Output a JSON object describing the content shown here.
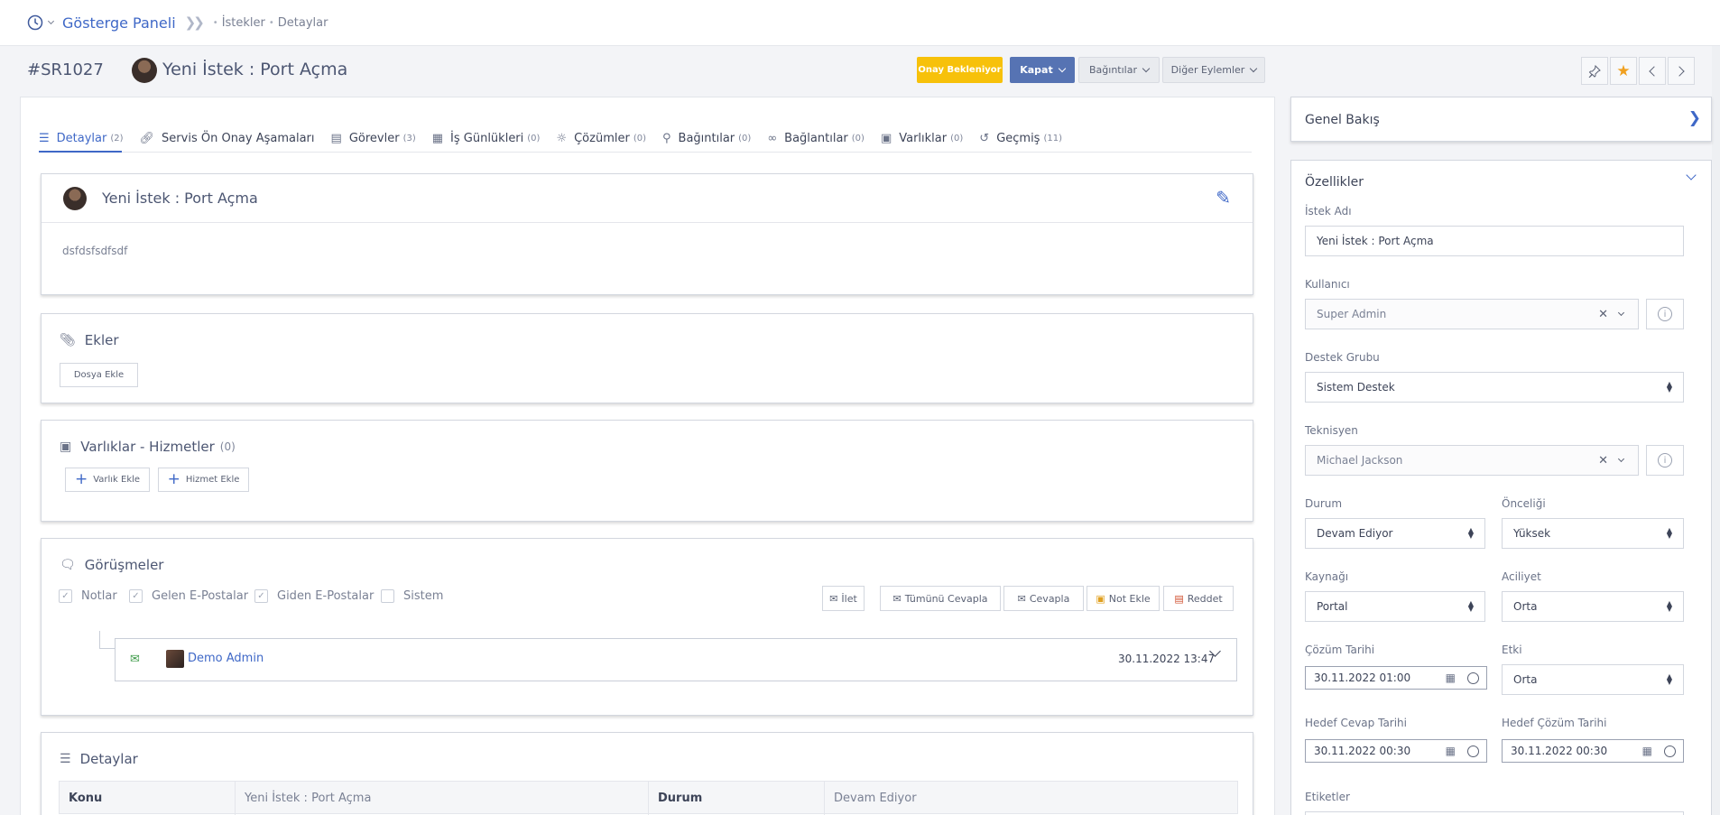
{
  "header": {
    "dashboard": "Gösterge Paneli",
    "breadcrumb": [
      "İstekler",
      "Detaylar"
    ]
  },
  "record": {
    "id": "#SR1027",
    "title": "Yeni İstek : Port Açma"
  },
  "actions": {
    "approval": "Onay Bekleniyor",
    "close": "Kapat",
    "relations": "Bağıntılar",
    "other": "Diğer Eylemler"
  },
  "tabs": [
    {
      "label": "Detaylar",
      "count": "(2)"
    },
    {
      "label": "Servis Ön Onay Aşamaları",
      "count": ""
    },
    {
      "label": "Görevler",
      "count": "(3)"
    },
    {
      "label": "İş Günlükleri",
      "count": "(0)"
    },
    {
      "label": "Çözümler",
      "count": "(0)"
    },
    {
      "label": "Bağıntılar",
      "count": "(0)"
    },
    {
      "label": "Bağlantılar",
      "count": "(0)"
    },
    {
      "label": "Varlıklar",
      "count": "(0)"
    },
    {
      "label": "Geçmiş",
      "count": "(11)"
    }
  ],
  "description": {
    "title": "Yeni İstek : Port Açma",
    "body": "dsfdsfsdfsdf"
  },
  "attachments": {
    "title": "Ekler",
    "add_file": "Dosya Ekle"
  },
  "assets": {
    "title": "Varlıklar - Hizmetler",
    "count": "(0)",
    "add_asset": "Varlık Ekle",
    "add_service": "Hizmet Ekle"
  },
  "conversations": {
    "title": "Görüşmeler",
    "filters": [
      "Notlar",
      "Gelen E-Postalar",
      "Giden E-Postalar",
      "Sistem"
    ],
    "buttons": [
      "İlet",
      "Tümünü Cevapla",
      "Cevapla",
      "Not Ekle",
      "Reddet"
    ],
    "message": {
      "author": "Demo Admin",
      "date": "30.11.2022 13:47"
    }
  },
  "details": {
    "title": "Detaylar",
    "subject_label": "Konu",
    "subject_value": "Yeni İstek : Port Açma",
    "status_label": "Durum",
    "status_value": "Devam Ediyor"
  },
  "sidebar": {
    "overview": "Genel Bakış",
    "properties": "Özellikler",
    "fields": {
      "request_name": {
        "label": "İstek Adı",
        "value": "Yeni İstek : Port Açma"
      },
      "user": {
        "label": "Kullanıcı",
        "value": "Super Admin"
      },
      "support_group": {
        "label": "Destek Grubu",
        "value": "Sistem Destek"
      },
      "technician": {
        "label": "Teknisyen",
        "value": "Michael Jackson"
      },
      "status": {
        "label": "Durum",
        "value": "Devam Ediyor"
      },
      "priority": {
        "label": "Önceliği",
        "value": "Yüksek"
      },
      "source": {
        "label": "Kaynağı",
        "value": "Portal"
      },
      "urgency": {
        "label": "Aciliyet",
        "value": "Orta"
      },
      "resolution_date": {
        "label": "Çözüm Tarihi",
        "value": "30.11.2022 01:00"
      },
      "impact": {
        "label": "Etki",
        "value": "Orta"
      },
      "target_response": {
        "label": "Hedef Cevap Tarihi",
        "value": "30.11.2022 00:30"
      },
      "target_resolution": {
        "label": "Hedef Çözüm Tarihi",
        "value": "30.11.2022 00:30"
      },
      "tags": {
        "label": "Etiketler"
      }
    }
  },
  "colors": {
    "accent": "#3f68c7",
    "approval": "#f7c10a",
    "close_button": "#5673b3"
  }
}
